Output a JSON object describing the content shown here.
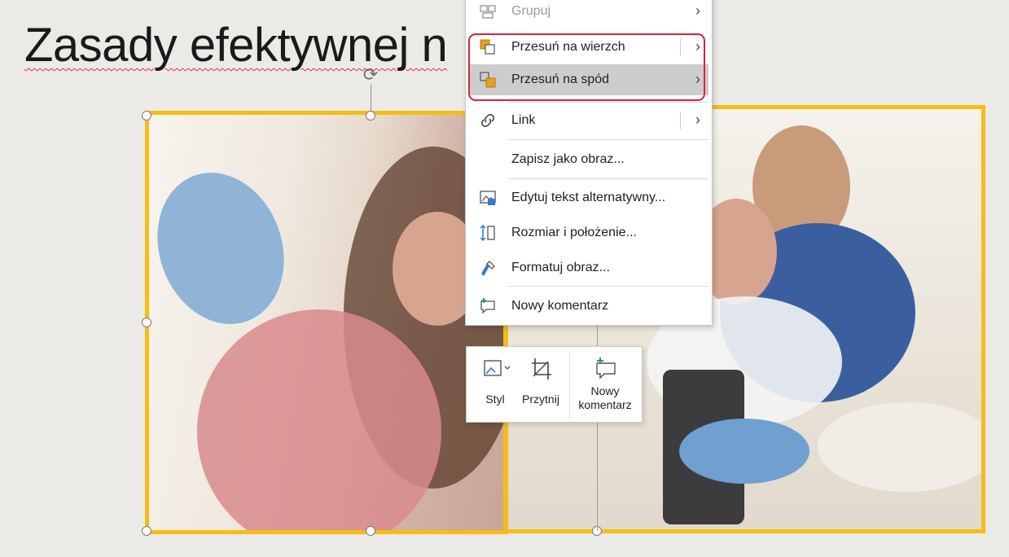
{
  "slide": {
    "title": "Zasady efektywnej n"
  },
  "context_menu": {
    "items": [
      {
        "label": "Grupuj",
        "icon": "group-icon",
        "state": "disabled",
        "submenu": true
      },
      {
        "label": "Przesuń na wierzch",
        "icon": "bring-to-front-icon",
        "state": "normal",
        "submenu": true
      },
      {
        "label": "Przesuń na spód",
        "icon": "send-to-back-icon",
        "state": "hover",
        "submenu": true
      },
      {
        "label": "Link",
        "icon": "link-icon",
        "state": "normal",
        "submenu": true
      },
      {
        "label": "Zapisz jako obraz...",
        "icon": "",
        "state": "normal",
        "submenu": false
      },
      {
        "label": "Edytuj tekst alternatywny...",
        "icon": "alt-text-icon",
        "state": "normal",
        "submenu": false
      },
      {
        "label": "Rozmiar i położenie...",
        "icon": "size-position-icon",
        "state": "normal",
        "submenu": false
      },
      {
        "label": "Formatuj obraz...",
        "icon": "format-picture-icon",
        "state": "normal",
        "submenu": false
      },
      {
        "label": "Nowy komentarz",
        "icon": "new-comment-icon",
        "state": "normal",
        "submenu": false
      }
    ]
  },
  "mini_toolbar": {
    "style_label": "Styl",
    "crop_label": "Przytnij",
    "comment_label_line1": "Nowy",
    "comment_label_line2": "komentarz"
  },
  "colors": {
    "selection_frame": "#f5bd16",
    "highlight_box": "#d7243a",
    "menu_hover": "#cdcdcd",
    "accent_icon_orange": "#e8a317",
    "accent_icon_blue": "#2f7bd1",
    "accent_icon_green": "#2c9b4e"
  }
}
